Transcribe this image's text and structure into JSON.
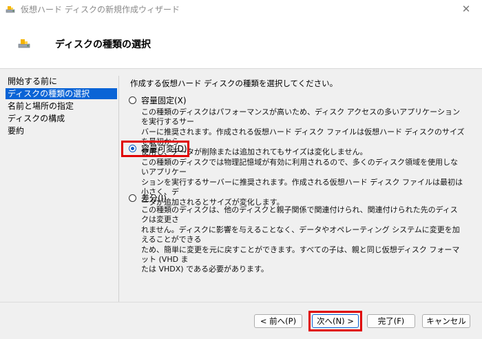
{
  "window": {
    "title": "仮想ハード ディスクの新規作成ウィザード",
    "close_glyph": "✕"
  },
  "header": {
    "title": "ディスクの種類の選択"
  },
  "nav": {
    "items": [
      {
        "label": "開始する前に",
        "active": false
      },
      {
        "label": "ディスクの種類の選択",
        "active": true
      },
      {
        "label": "名前と場所の指定",
        "active": false
      },
      {
        "label": "ディスクの構成",
        "active": false
      },
      {
        "label": "要約",
        "active": false
      }
    ]
  },
  "content": {
    "intro": "作成する仮想ハード ディスクの種類を選択してください。",
    "options": [
      {
        "label": "容量固定(X)",
        "selected": false,
        "desc": [
          "この種類のディスクはパフォーマンスが高いため、ディスク アクセスの多いアプリケーションを実行するサー",
          "バーに推奨されます。作成される仮想ハード ディスク ファイルは仮想ハード ディスクのサイズを最初から",
          "使用し、データが削除または追加されてもサイズは変化しません。"
        ]
      },
      {
        "label": "容量可変(D)",
        "selected": true,
        "desc": [
          "この種類のディスクでは物理記憶域が有効に利用されるので、多くのディスク領域を使用しないアプリケー",
          "ションを実行するサーバーに推奨されます。作成される仮想ハード ディスク ファイルは最初は小さく、デ",
          "ータが追加されるとサイズが変化します。"
        ]
      },
      {
        "label": "差分(I)",
        "selected": false,
        "desc": [
          "この種類のディスクは、他のディスクと親子関係で関連付けられ、関連付けられた先のディスクは変更さ",
          "れません。ディスクに影響を与えることなく、データやオペレーティング システムに変更を加えることができる",
          "ため、簡単に変更を元に戻すことができます。すべての子は、親と同じ仮想ディスク フォーマット (VHD ま",
          "たは VHDX) である必要があります。"
        ]
      }
    ]
  },
  "footer": {
    "prev_label": "< 前へ(P)",
    "next_label": "次へ(N) >",
    "finish_label": "完了(F)",
    "cancel_label": "キャンセル"
  },
  "colors": {
    "accent": "#0a64d6",
    "highlight": "#e00000"
  }
}
